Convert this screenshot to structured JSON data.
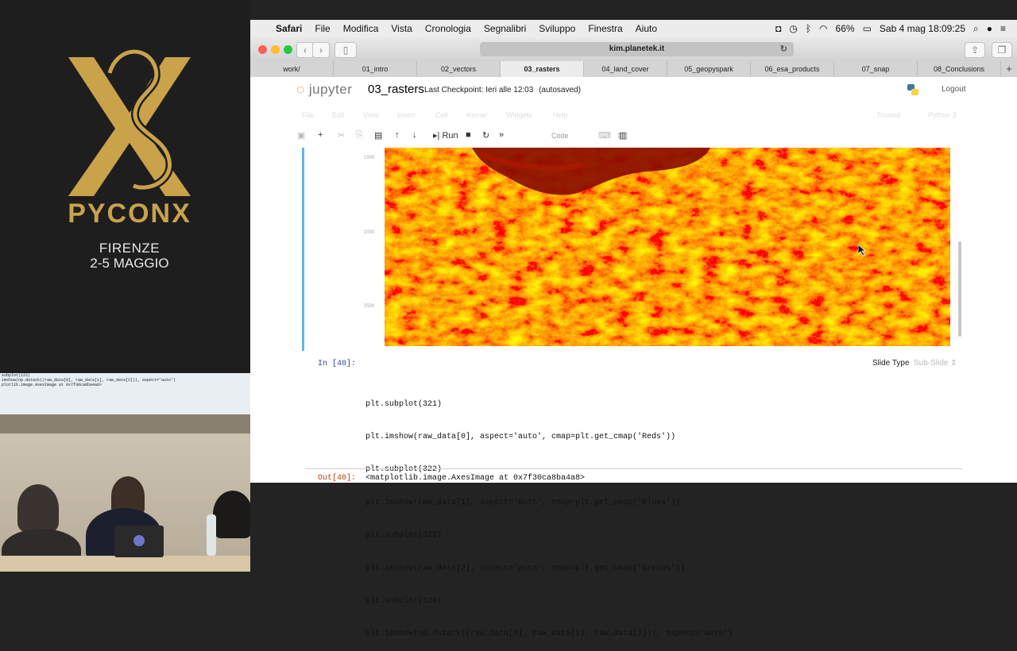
{
  "conference": {
    "logo_text": "PYCONX",
    "city": "FIRENZE",
    "dates": "2-5 MAGGIO"
  },
  "camera": {
    "screen_lines": [
      "subplot(122)",
      "imshow(np.dstack((raw_data[0], raw_data[1], raw_data[2])), aspect='auto')",
      "plotlib.image.AxesImage at 0x7f30ca8ba4a8>"
    ]
  },
  "menubar": {
    "app": "Safari",
    "items": [
      "File",
      "Modifica",
      "Vista",
      "Cronologia",
      "Segnalibri",
      "Sviluppo",
      "Finestra",
      "Aiuto"
    ],
    "battery": "66%",
    "datetime": "Sab 4 mag  18:09:25"
  },
  "browser": {
    "url": "kim.planetek.it",
    "tabs": [
      "work/",
      "01_intro",
      "02_vectors",
      "03_rasters",
      "04_land_cover",
      "05_geopyspark",
      "06_esa_products",
      "07_snap",
      "08_Conclusions"
    ],
    "active_tab": "03_rasters"
  },
  "notebook": {
    "logo": "jupyter",
    "title": "03_rasters",
    "checkpoint": "Last Checkpoint: Ieri alle 12:03",
    "autosaved": "(autosaved)",
    "logout": "Logout",
    "menu": [
      "File",
      "Edit",
      "View",
      "Insert",
      "Cell",
      "Kernel",
      "Widgets",
      "Help"
    ],
    "trusted": "Trusted",
    "kernel": "Python 3",
    "run_label": "Run",
    "cell_type": "Code",
    "y_ticks": [
      "1500",
      "2000",
      "2500"
    ],
    "in_prompt": "In [40]:",
    "slide_type_label": "Slide Type",
    "slide_type_value": "Sub-Slide",
    "code_lines": [
      "plt.subplot(321)",
      "plt.imshow(raw_data[0], aspect='auto', cmap=plt.get_cmap('Reds'))",
      "plt.subplot(322)",
      "plt.imshow(raw_data[1], aspect='auto', cmap=plt.get_cmap('Blues'))",
      "plt.subplot(323)",
      "plt.imshow(raw_data[2], aspect='auto', cmap=plt.get_cmap('Greens'))",
      "plt.subplot(324)",
      "plt.imshow(np.dstack((raw_data[0], raw_data[1], raw_data[2])), aspect='auto')"
    ],
    "out_prompt": "Out[40]:",
    "out_text": "<matplotlib.image.AxesImage at 0x7f30ca8ba4a8>"
  },
  "colors": {
    "jupyter_orange": "#f37726",
    "prompt_in": "#2f3fa8",
    "prompt_out": "#c63a00",
    "pycon_gold": "#c9a24a"
  }
}
